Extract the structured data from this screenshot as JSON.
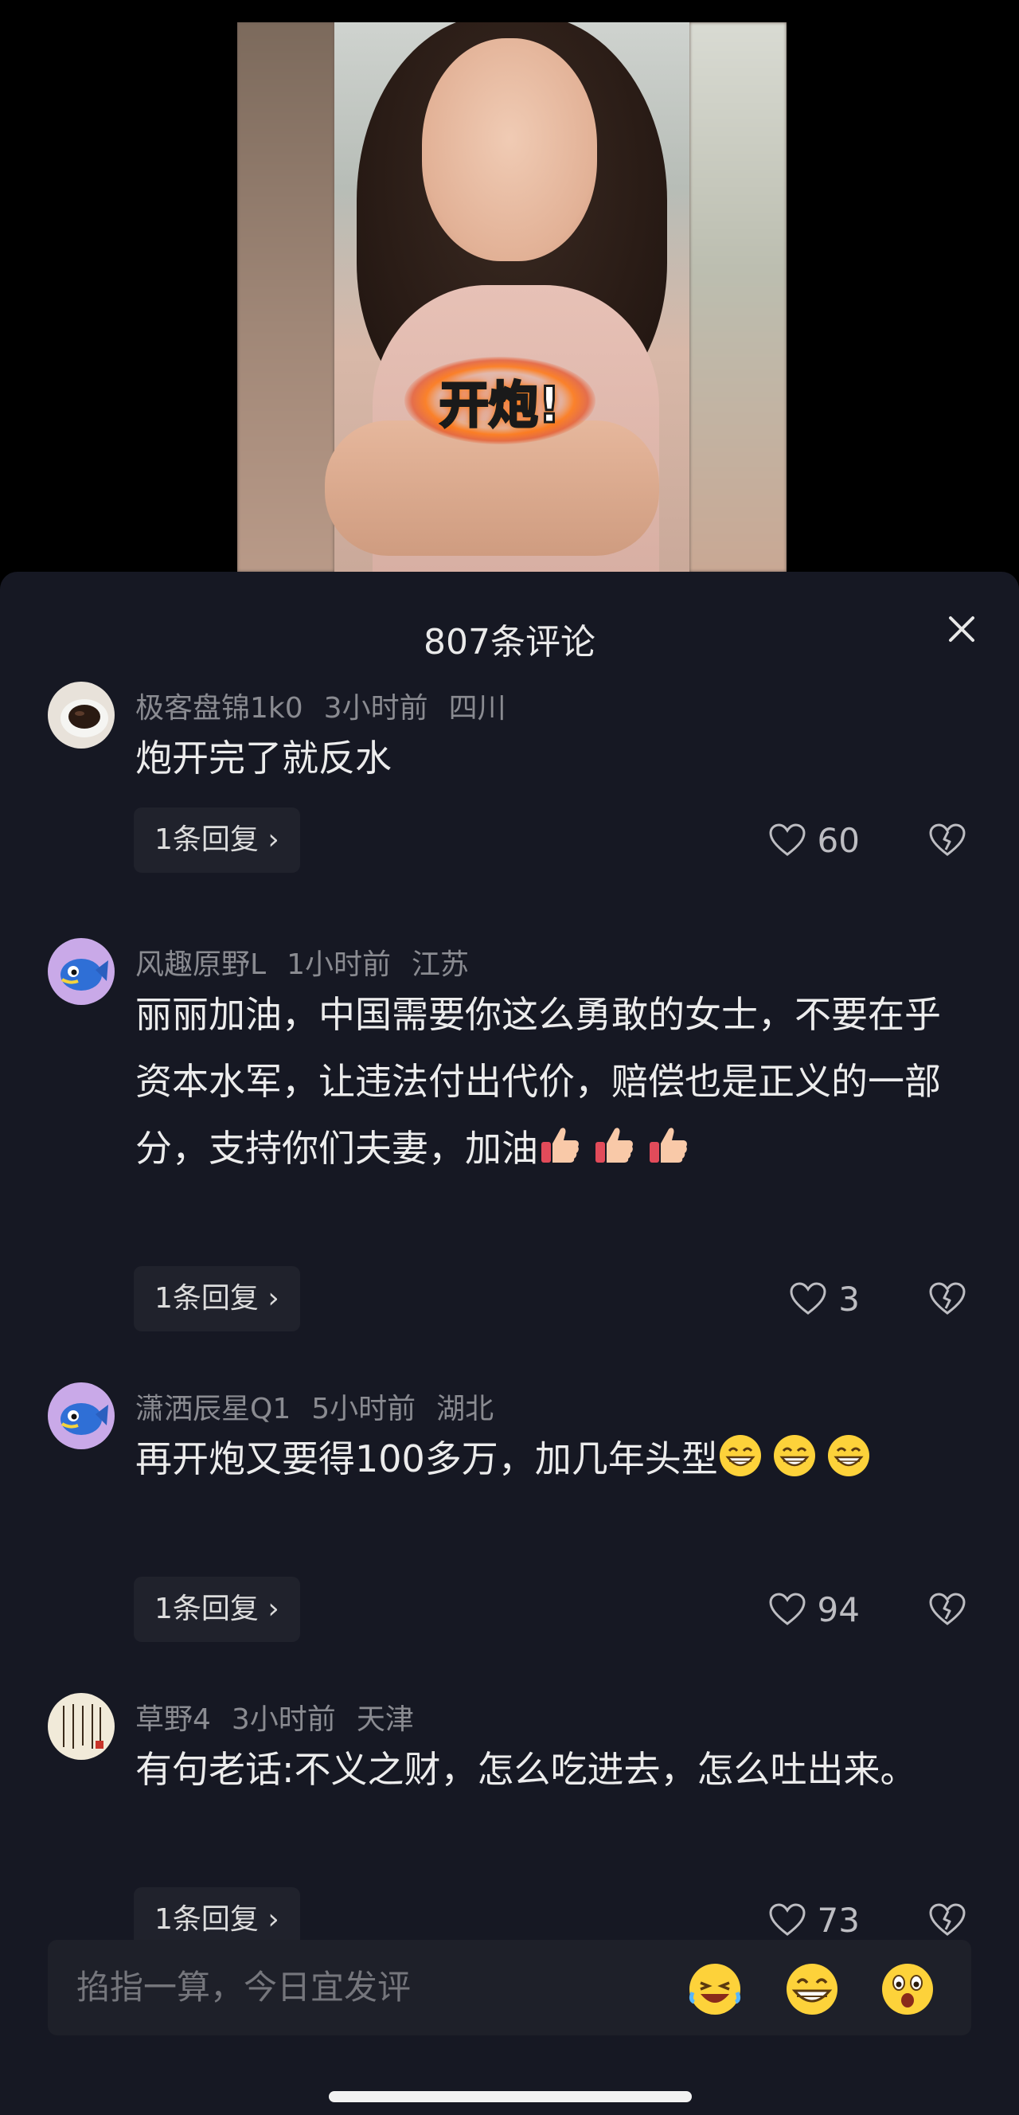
{
  "video": {
    "sticker_text": "开炮!"
  },
  "panel": {
    "title": "807条评论",
    "close_icon": "close-icon"
  },
  "comments": [
    {
      "username": "极客盘锦1k0",
      "time": "3小时前",
      "location": "四川",
      "text": "炮开完了就反水",
      "reply_label": "1条回复 ›",
      "likes": "60"
    },
    {
      "username": "风趣原野L",
      "time": "1小时前",
      "location": "江苏",
      "text": "丽丽加油，中国需要你这么勇敢的女士，不要在乎资本水军，让违法付出代价，赔偿也是正义的一部分，支持你们夫妻，加油",
      "reply_label": "1条回复 ›",
      "likes": "3"
    },
    {
      "username": "潇洒辰星Q1",
      "time": "5小时前",
      "location": "湖北",
      "text": "再开炮又要得100多万，加几年头型",
      "reply_label": "1条回复 ›",
      "likes": "94"
    },
    {
      "username": "草野4",
      "time": "3小时前",
      "location": "天津",
      "text": "有句老话:不义之财，怎么吃进去，怎么吐出来。",
      "reply_label": "1条回复 ›",
      "likes": "73"
    }
  ],
  "input": {
    "placeholder": "掐指一算，今日宜发评"
  },
  "colors": {
    "panel_bg": "#161823",
    "reply_bg": "#20222c",
    "meta_text": "#8a8b91"
  }
}
